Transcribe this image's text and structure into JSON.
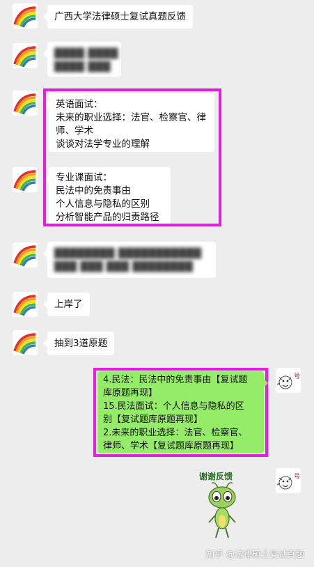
{
  "messages": [
    {
      "id": "m1",
      "lines": [
        "广西大学法律硕士复试真题反馈"
      ]
    },
    {
      "id": "m2",
      "lines": [
        "████ ████",
        "████ ███"
      ],
      "blurred": true
    },
    {
      "id": "m3",
      "lines": [
        "英语面试：",
        "未来的职业选择：法官、检察官、律",
        "师、学术",
        "谈谈对法学专业的理解"
      ]
    },
    {
      "id": "m4",
      "lines": [
        "专业课面试：",
        "民法中的免责事由",
        "个人信息与隐私的区别",
        "分析智能产品的归责路径"
      ]
    },
    {
      "id": "m5",
      "lines": [
        "████████ ███████████",
        "███ ███ ███ ████████"
      ],
      "blurred": true
    },
    {
      "id": "m6",
      "lines": [
        "上岸了"
      ]
    },
    {
      "id": "m7",
      "lines": [
        "抽到3道原题"
      ]
    },
    {
      "id": "m8",
      "lines": [
        "4.民法：民法中的免责事由【复试题",
        "库原题再现】",
        "15.民法面试：个人信息与隐私的区",
        "别【复试题库原题再现】",
        "2.未来的职业选择：法官、检察官、",
        "律师、学术【复试题库原题再现】"
      ]
    }
  ],
  "sticker": {
    "caption": "谢谢反馈",
    "icon": "grasshopper-sticker"
  },
  "avatars": {
    "student": "rainbow-avatar",
    "tutor": "cartoon-avatar",
    "tutor_badge": "号"
  },
  "colors": {
    "highlight": "#e41ee1",
    "sent_bubble": "#95ec69",
    "background": "#ededed"
  },
  "watermark": "知乎 @法律硕士复试真题"
}
